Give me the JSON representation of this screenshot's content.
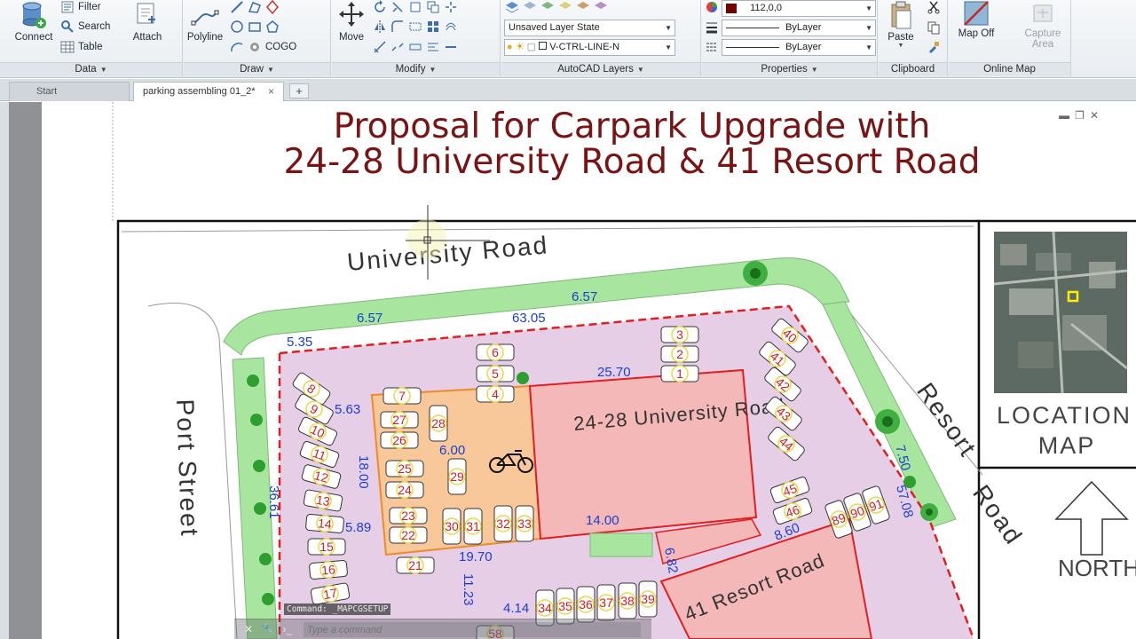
{
  "ribbon": {
    "data_panel": {
      "title": "Data",
      "connect_label": "Connect",
      "filter_label": "Filter",
      "search_label": "Search",
      "table_label": "Table"
    },
    "draw_panel": {
      "title": "Draw",
      "attach_label": "Attach",
      "polyline_label": "Polyline",
      "cogo_label": "COGO"
    },
    "modify_panel": {
      "title": "Modify",
      "move_label": "Move"
    },
    "layers_panel": {
      "title": "AutoCAD Layers",
      "layer_state": "Unsaved Layer State",
      "current_layer": "V-CTRL-LINE-N"
    },
    "properties_panel": {
      "title": "Properties",
      "color_value": "112,0,0",
      "linetype_value": "ByLayer",
      "lineweight_value": "ByLayer"
    },
    "clipboard_panel": {
      "title": "Clipboard",
      "paste_label": "Paste"
    },
    "online_map_panel": {
      "title": "Online Map",
      "map_off_label": "Map Off",
      "capture_label": "Capture",
      "capture_label2": "Area"
    }
  },
  "tabs": {
    "start_label": "Start",
    "active_label": "parking assembling 01_2*",
    "close_symbol": "×",
    "add_symbol": "+"
  },
  "drawing": {
    "title_line1": "Proposal for Carpark Upgrade with",
    "title_line2": "24-28 University Road & 41 Resort Road",
    "street_university": "University Road",
    "street_port": "Port Street",
    "street_resort_a": "Resort",
    "street_resort_b": "Road",
    "building_university": "24-28 University Road",
    "building_resort": "41 Resort Road",
    "location_map_line1": "LOCATION",
    "location_map_line2": "MAP",
    "north_label": "NORTH",
    "dimensions": {
      "d_6_57_a": "6.57",
      "d_6_57_b": "6.57",
      "d_5_35": "5.35",
      "d_63_05": "63.05",
      "d_25_70": "25.70",
      "d_5_63": "5.63",
      "d_6_00": "6.00",
      "d_18_00": "18.00",
      "d_36_61": "36.61",
      "d_5_89": "5.89",
      "d_19_70": "19.70",
      "d_14_00": "14.00",
      "d_11_23": "11.23",
      "d_4_14": "4.14",
      "d_6_82": "6.82",
      "d_8_60": "8.60",
      "d_7_50": "7.50",
      "d_57_08": "57.08"
    },
    "parking_numbers": [
      "1",
      "2",
      "3",
      "4",
      "5",
      "6",
      "7",
      "8",
      "9",
      "10",
      "11",
      "12",
      "13",
      "14",
      "15",
      "16",
      "17",
      "21",
      "22",
      "23",
      "24",
      "25",
      "26",
      "27",
      "28",
      "29",
      "30",
      "31",
      "32",
      "33",
      "34",
      "35",
      "36",
      "37",
      "38",
      "39",
      "40",
      "41",
      "42",
      "43",
      "44",
      "45",
      "46",
      "58",
      "89",
      "90",
      "91"
    ]
  },
  "command": {
    "history": "Command: _MAPCGSETUP",
    "placeholder": "Type a command"
  },
  "colors": {
    "title_red": "#7a1414",
    "dimension_blue": "#1a3fd0",
    "parking_purple": "#e6cfe6",
    "building_pink": "#f5b8b8",
    "green_strip": "#a8e6a0",
    "boundary_red": "#e02020",
    "number_red": "#d02020"
  }
}
